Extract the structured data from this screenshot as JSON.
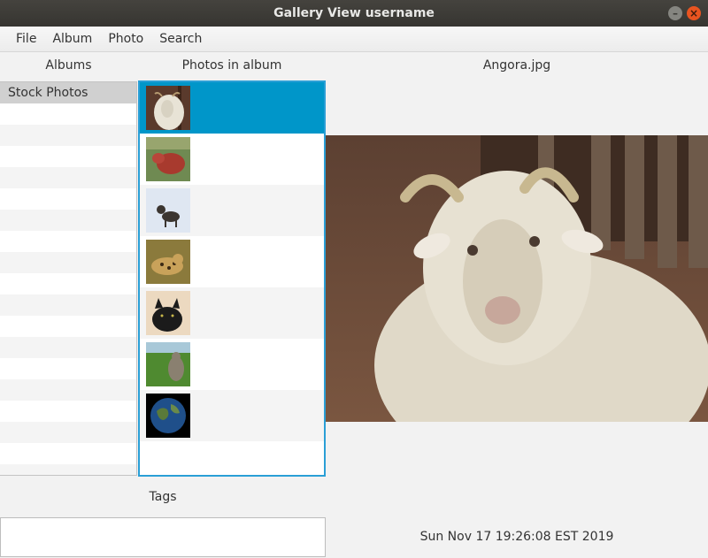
{
  "window": {
    "title": "Gallery View username"
  },
  "menu": [
    "File",
    "Album",
    "Photo",
    "Search"
  ],
  "albums": {
    "header": "Albums",
    "items": [
      "Stock Photos"
    ],
    "selected_index": 0
  },
  "photos": {
    "header": "Photos in album",
    "items": [
      {
        "thumb_icon": "goat-thumbnail"
      },
      {
        "thumb_icon": "red-fur-animal-thumbnail"
      },
      {
        "thumb_icon": "cat-in-snow-thumbnail"
      },
      {
        "thumb_icon": "spotted-cat-thumbnail"
      },
      {
        "thumb_icon": "black-cat-thumbnail"
      },
      {
        "thumb_icon": "tabby-cat-on-grass-thumbnail"
      },
      {
        "thumb_icon": "earth-thumbnail"
      }
    ],
    "selected_index": 0
  },
  "preview": {
    "filename": "Angora.jpg",
    "image_icon": "angora-goat-photo"
  },
  "tags": {
    "label": "Tags",
    "value": ""
  },
  "status": {
    "datetime": "Sun Nov 17 19:26:08 EST 2019"
  },
  "colors": {
    "selection": "#0096c9",
    "focus_border": "#2a9fd6",
    "titlebar": "#3c3b37",
    "close_button": "#e95420"
  }
}
